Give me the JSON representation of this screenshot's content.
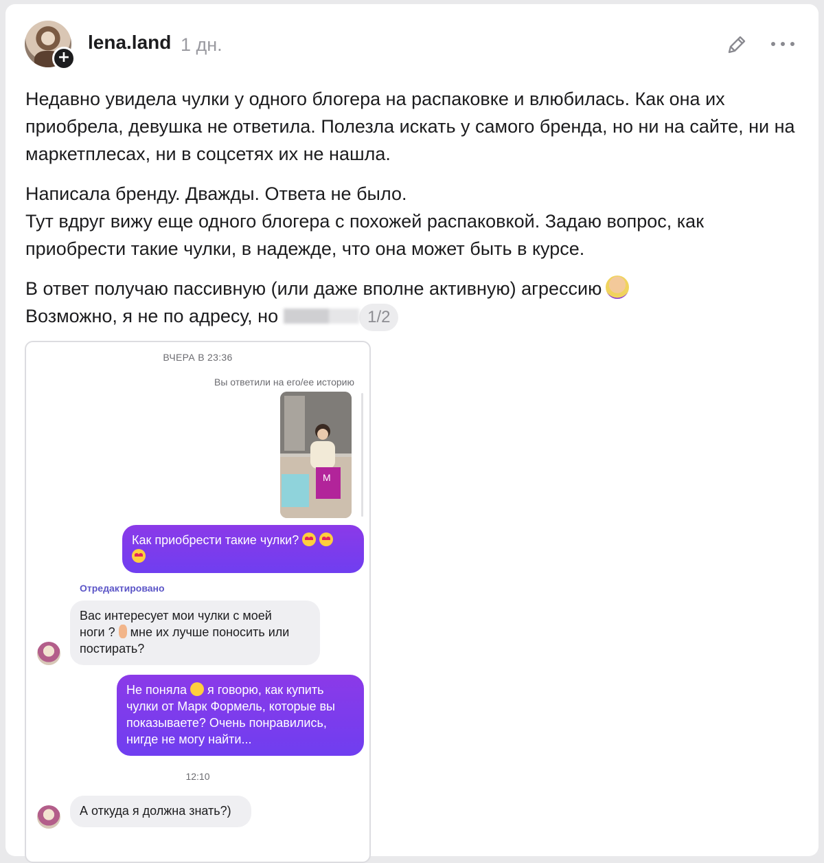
{
  "post": {
    "username": "lena.land",
    "time_ago": "1 дн.",
    "paragraphs": [
      "Недавно увидела чулки у одного блогера на распаковке и влюбилась. Как она их приобрела, девушка не ответила. Полезла искать у самого бренда, но ни на сайте, ни на маркетплесах, ни в соцсетях их не нашла.",
      "Написала бренду. Дважды. Ответа не было.",
      "Тут вдруг вижу еще одного блогера с похожей распаковкой. Задаю вопрос, как приобрести такие чулки, в надежде, что она может быть в курсе.",
      "В ответ получаю пассивную (или даже вполне активную) агрессию",
      "Возможно, я не по адресу, но"
    ],
    "pager": "1/2"
  },
  "chat": {
    "date_label": "ВЧЕРА В 23:36",
    "reply_note": "Вы ответили на его/ее историю",
    "msg1": "Как приобрести такие чулки?",
    "edited_label": "Отредактировано",
    "msg2_a": "Вас интересует мои чулки с моей",
    "msg2_b": "ноги ?",
    "msg2_c": "мне их лучше поносить или",
    "msg2_d": "постирать?",
    "msg3_a": "Не поняла",
    "msg3_b": "я говорю, как купить",
    "msg3_c": "чулки от Марк Формель, которые вы",
    "msg3_d": "показываете? Очень понравились,",
    "msg3_e": "нигде не могу найти...",
    "time2": "12:10",
    "msg4": "А откуда я должна знать?)"
  },
  "icons": [
    "edit-icon",
    "more-icon",
    "plus-icon",
    "facepalm-emoji",
    "heart-eyes-emoji",
    "ear-emoji",
    "sweat-smile-emoji"
  ]
}
